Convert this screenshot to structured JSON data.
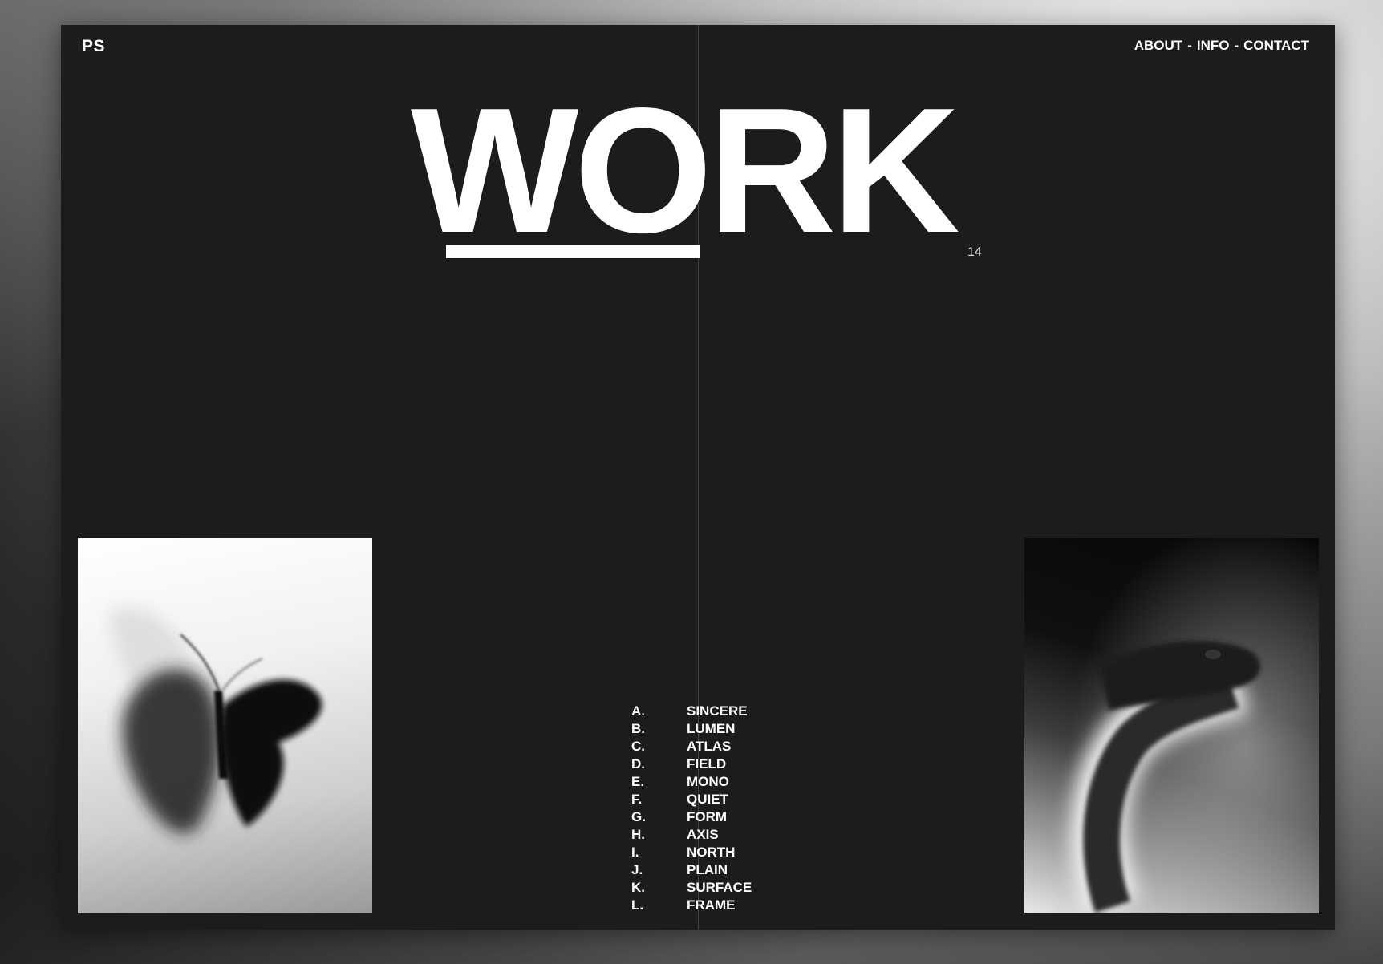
{
  "header": {
    "logo": "PS",
    "nav": [
      "ABOUT",
      "-",
      "INFO",
      "-",
      "CONTACT"
    ]
  },
  "hero": {
    "title": "WORK",
    "count": "14"
  },
  "projects": [
    {
      "letter": "A.",
      "name": "SINCERE"
    },
    {
      "letter": "B.",
      "name": "LUMEN"
    },
    {
      "letter": "C.",
      "name": "ATLAS"
    },
    {
      "letter": "D.",
      "name": "FIELD"
    },
    {
      "letter": "E.",
      "name": "MONO"
    },
    {
      "letter": "F.",
      "name": "QUIET"
    },
    {
      "letter": "G.",
      "name": "FORM"
    },
    {
      "letter": "H.",
      "name": "AXIS"
    },
    {
      "letter": "I.",
      "name": "NORTH"
    },
    {
      "letter": "J.",
      "name": "PLAIN"
    },
    {
      "letter": "K.",
      "name": "SURFACE"
    },
    {
      "letter": "L.",
      "name": "FRAME"
    }
  ],
  "images": {
    "left": "butterfly-photo",
    "right": "snake-photo"
  },
  "colors": {
    "page_background": "#1c1c1c",
    "text": "#ffffff"
  }
}
